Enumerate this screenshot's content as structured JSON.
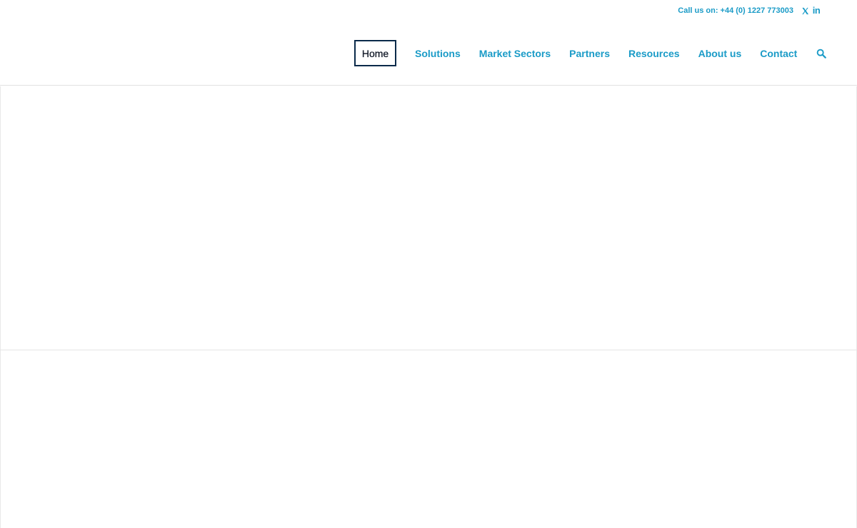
{
  "header": {
    "phone_text": "Call us on: +44 (0) 1227 773003",
    "social": [
      {
        "name": "x-twitter-icon"
      },
      {
        "name": "linkedin-icon",
        "glyph": "in"
      }
    ],
    "nav": {
      "items": [
        {
          "label": "Home",
          "active": true
        },
        {
          "label": "Solutions"
        },
        {
          "label": "Market Sectors"
        },
        {
          "label": "Partners"
        },
        {
          "label": "Resources"
        },
        {
          "label": "About us"
        },
        {
          "label": "Contact"
        }
      ],
      "search_icon": "search-icon"
    }
  },
  "colors": {
    "accent": "#1a9bc7",
    "active_border": "#0a2a4a",
    "active_text": "#111827",
    "divider": "#e1e1e1"
  }
}
